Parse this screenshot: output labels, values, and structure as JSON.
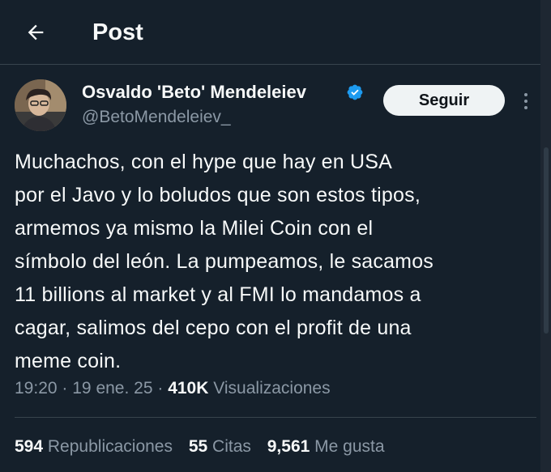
{
  "header": {
    "title": "Post"
  },
  "author": {
    "name": "Osvaldo 'Beto' Mendeleiev",
    "handle": "@BetoMendeleiev_",
    "verified": true
  },
  "follow_label": "Seguir",
  "tweet": {
    "text": "Muchachos, con el hype que hay en USA\npor el Javo y lo boludos que son estos tipos,\narmemos ya mismo la Milei Coin con el\nsímbolo del león. La pumpeamos, le sacamos\n11 billions al market y al FMI lo mandamos a\ncagar, salimos del cepo con el profit de una\nmeme coin."
  },
  "meta": {
    "time": "19:20",
    "sep": "·",
    "date": "19 ene. 25",
    "views_count": "410K",
    "views_label": "Visualizaciones"
  },
  "stats": [
    {
      "count": "594",
      "label": "Republicaciones"
    },
    {
      "count": "55",
      "label": "Citas"
    },
    {
      "count": "9,561",
      "label": "Me gusta"
    }
  ],
  "colors": {
    "background": "#15202b",
    "text": "#f7f9f9",
    "secondary": "#8b98a5",
    "verified": "#1d9bf0",
    "button": "#eff3f4"
  }
}
